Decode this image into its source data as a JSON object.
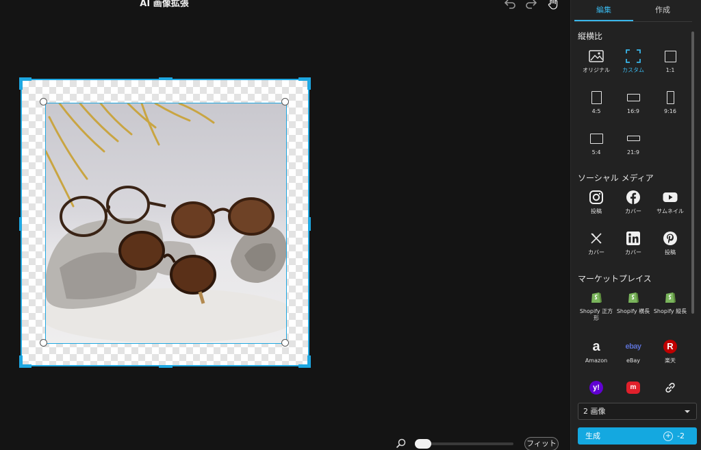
{
  "app": {
    "title": "AI 画像拡張"
  },
  "toolbar": {
    "undo_icon": "undo-icon",
    "redo_icon": "redo-icon",
    "hand_icon": "hand-icon"
  },
  "canvas": {
    "fit_label": "フィット",
    "zoom_level": 0.1
  },
  "panel": {
    "tabs": [
      {
        "label": "編集",
        "active": true
      },
      {
        "label": "作成",
        "active": false
      }
    ],
    "aspect": {
      "title": "縦横比",
      "items": [
        {
          "label": "オリジナル",
          "icon": "image-icon"
        },
        {
          "label": "カスタム",
          "icon": "custom-crop-icon",
          "active": true
        },
        {
          "label": "1:1",
          "icon": "ratio-1-1-icon"
        },
        {
          "label": "4:5",
          "icon": "ratio-4-5-icon"
        },
        {
          "label": "16:9",
          "icon": "ratio-16-9-icon"
        },
        {
          "label": "9:16",
          "icon": "ratio-9-16-icon"
        },
        {
          "label": "5:4",
          "icon": "ratio-5-4-icon"
        },
        {
          "label": "21:9",
          "icon": "ratio-21-9-icon"
        }
      ]
    },
    "social": {
      "title": "ソーシャル メディア",
      "items": [
        {
          "label": "投稿",
          "icon": "instagram-icon"
        },
        {
          "label": "カバー",
          "icon": "facebook-icon"
        },
        {
          "label": "サムネイル",
          "icon": "youtube-icon"
        },
        {
          "label": "カバー",
          "icon": "x-icon"
        },
        {
          "label": "カバー",
          "icon": "linkedin-icon"
        },
        {
          "label": "投稿",
          "icon": "pinterest-icon"
        }
      ]
    },
    "marketplace": {
      "title": "マーケットプレイス",
      "items": [
        {
          "label": "Shopify 正方形",
          "icon": "shopify-icon"
        },
        {
          "label": "Shopify 横長",
          "icon": "shopify-icon"
        },
        {
          "label": "Shopify 縦長",
          "icon": "shopify-icon"
        },
        {
          "label": "Amazon",
          "icon": "amazon-icon",
          "logo_text": "a"
        },
        {
          "label": "eBay",
          "icon": "ebay-icon",
          "logo_text": "ebay"
        },
        {
          "label": "楽天",
          "icon": "rakuten-icon",
          "logo_text": "R"
        },
        {
          "label": "",
          "icon": "yahoo-icon",
          "logo_text": "y!"
        },
        {
          "label": "",
          "icon": "mercari-icon",
          "logo_text": "m"
        },
        {
          "label": "",
          "icon": "link-icon"
        }
      ]
    },
    "count_select": {
      "value": "2 画像"
    },
    "generate": {
      "label": "生成",
      "credit": "-2"
    }
  },
  "colors": {
    "accent": "#1ea7e1",
    "panel_bg": "#222222",
    "canvas_bg": "#141414"
  }
}
